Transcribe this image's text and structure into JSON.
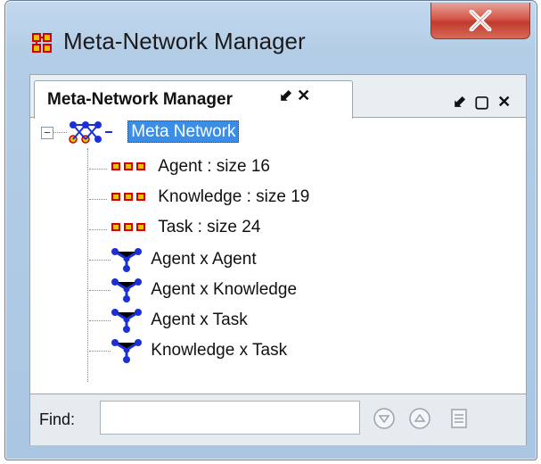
{
  "window": {
    "title": "Meta-Network Manager",
    "close_glyph": "X"
  },
  "panel": {
    "tab_label": "Meta-Network Manager",
    "tab_icons": "⬋ ✕",
    "window_icons": "⬋ ▢ ✕"
  },
  "tree": {
    "root": "Meta Network",
    "expander": "−",
    "nodesets": [
      {
        "label": "Agent : size 16",
        "icon": "nodeset-icon"
      },
      {
        "label": "Knowledge : size 19",
        "icon": "nodeset-icon"
      },
      {
        "label": "Task : size 24",
        "icon": "nodeset-icon"
      }
    ],
    "networks": [
      {
        "label": "Agent x Agent",
        "icon": "network-icon"
      },
      {
        "label": "Agent x Knowledge",
        "icon": "network-icon"
      },
      {
        "label": "Agent x Task",
        "icon": "network-icon"
      },
      {
        "label": "Knowledge x Task",
        "icon": "network-icon"
      }
    ]
  },
  "find": {
    "label": "Find:",
    "value": "",
    "placeholder": "",
    "buttons": [
      "find-next-icon",
      "find-previous-icon",
      "find-list-icon"
    ]
  },
  "colors": {
    "selection": "#3a8ee8",
    "network_icon": "#1b2fd9",
    "nodeset_icon_fill": "#e8c400",
    "nodeset_icon_border": "#d40000",
    "close_button": "#c9473a"
  }
}
